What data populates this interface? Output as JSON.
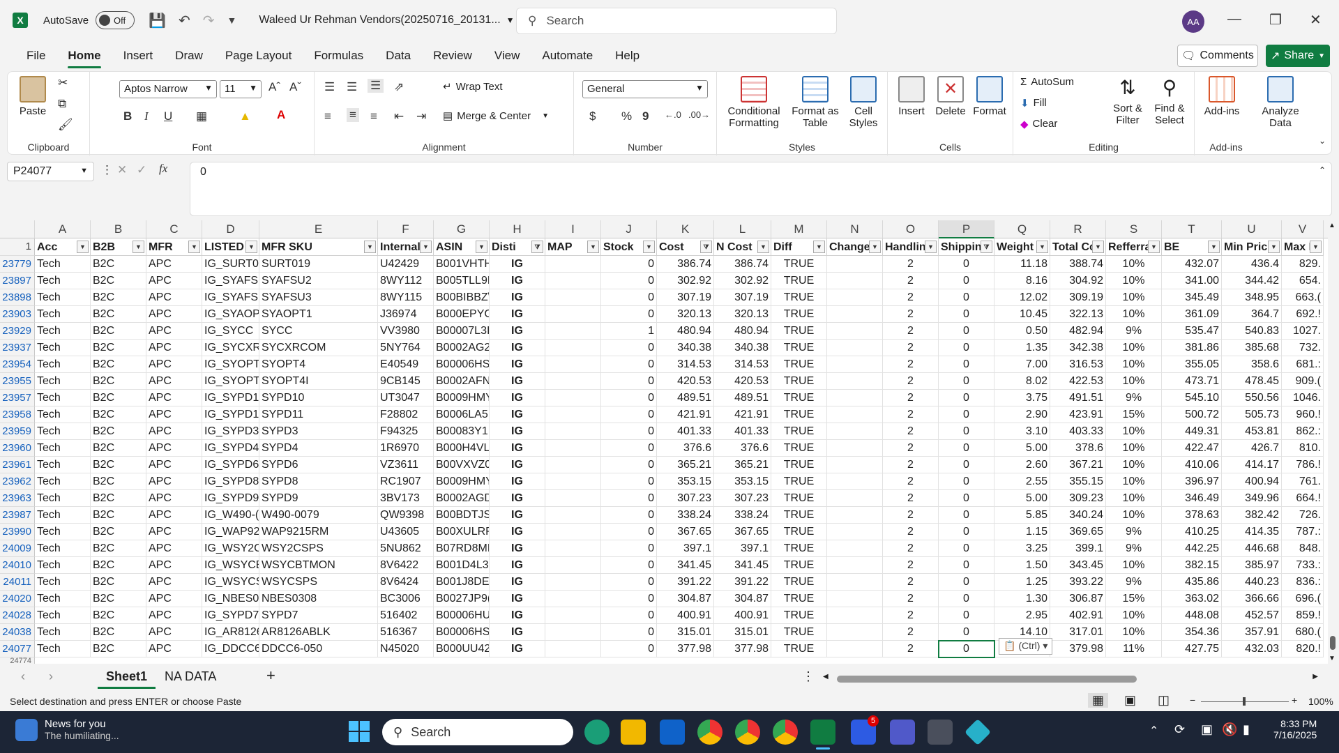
{
  "titlebar": {
    "autosave_label": "AutoSave",
    "autosave_state": "Off",
    "document_title": "Waleed Ur Rehman Vendors(20250716_20131...",
    "search_placeholder": "Search",
    "avatar_initials": "AA"
  },
  "menu": {
    "tabs": [
      "File",
      "Home",
      "Insert",
      "Draw",
      "Page Layout",
      "Formulas",
      "Data",
      "Review",
      "View",
      "Automate",
      "Help"
    ],
    "active": "Home",
    "comments_label": "Comments",
    "share_label": "Share"
  },
  "ribbon": {
    "clipboard": {
      "label": "Clipboard",
      "paste": "Paste"
    },
    "font": {
      "label": "Font",
      "name": "Aptos Narrow",
      "size": "11",
      "bold": "B",
      "italic": "I",
      "underline": "U"
    },
    "alignment": {
      "label": "Alignment",
      "wrap_text": "Wrap Text",
      "merge_center": "Merge & Center"
    },
    "number": {
      "label": "Number",
      "format": "General",
      "currency": "$",
      "percent": "%",
      "comma": "9"
    },
    "styles": {
      "label": "Styles",
      "conditional": [
        "Conditional",
        "Formatting"
      ],
      "format_table": [
        "Format as",
        "Table"
      ],
      "cell_styles": [
        "Cell",
        "Styles"
      ]
    },
    "cells": {
      "label": "Cells",
      "insert": "Insert",
      "delete": "Delete",
      "format": "Format"
    },
    "editing": {
      "label": "Editing",
      "autosum": "AutoSum",
      "fill": "Fill",
      "clear": "Clear",
      "sort_filter": [
        "Sort &",
        "Filter"
      ],
      "find_select": [
        "Find &",
        "Select"
      ]
    },
    "addins": {
      "label": "Add-ins",
      "addins": "Add-ins",
      "analyze": [
        "Analyze",
        "Data"
      ]
    }
  },
  "formula_bar": {
    "name_box": "P24077",
    "formula": "0"
  },
  "grid": {
    "columns": [
      "A",
      "B",
      "C",
      "D",
      "E",
      "F",
      "G",
      "H",
      "I",
      "J",
      "K",
      "L",
      "M",
      "N",
      "O",
      "P",
      "Q",
      "R",
      "S",
      "T",
      "U",
      "V"
    ],
    "selected_column": "P",
    "header_row_number": "1",
    "headers": [
      "Acc",
      "B2B",
      "MFR",
      "LISTED",
      "MFR SKU",
      "Internal",
      "ASIN",
      "Disti",
      "MAP",
      "Stock",
      "Cost",
      "N Cost",
      "Diff",
      "Change",
      "Handlin",
      "Shippin",
      "Weight",
      "Total Co",
      "Refferra",
      "BE",
      "Min Pric",
      "Max Pr"
    ],
    "filtered_columns": [
      "H",
      "K",
      "P"
    ],
    "rows": [
      [
        "23779",
        "Tech",
        "B2C",
        "APC",
        "IG_SURT01",
        "SURT019",
        "U42429",
        "B001VHTH",
        "IG",
        "",
        "0",
        "386.74",
        "386.74",
        "TRUE",
        "",
        "2",
        "0",
        "11.18",
        "388.74",
        "10%",
        "432.07",
        "436.4",
        "829."
      ],
      [
        "23897",
        "Tech",
        "B2C",
        "APC",
        "IG_SYAFSL",
        "SYAFSU2",
        "8WY112",
        "B005TLL9E",
        "IG",
        "",
        "0",
        "302.92",
        "302.92",
        "TRUE",
        "",
        "2",
        "0",
        "8.16",
        "304.92",
        "10%",
        "341.00",
        "344.42",
        "654."
      ],
      [
        "23898",
        "Tech",
        "B2C",
        "APC",
        "IG_SYAFSL",
        "SYAFSU3",
        "8WY115",
        "B00BIBBZ\\",
        "IG",
        "",
        "0",
        "307.19",
        "307.19",
        "TRUE",
        "",
        "2",
        "0",
        "12.02",
        "309.19",
        "10%",
        "345.49",
        "348.95",
        "663.("
      ],
      [
        "23903",
        "Tech",
        "B2C",
        "APC",
        "IG_SYAOP",
        "SYAOPT1",
        "J36974",
        "B000EPYG",
        "IG",
        "",
        "0",
        "320.13",
        "320.13",
        "TRUE",
        "",
        "2",
        "0",
        "10.45",
        "322.13",
        "10%",
        "361.09",
        "364.7",
        "692.!"
      ],
      [
        "23929",
        "Tech",
        "B2C",
        "APC",
        "IG_SYCC",
        "SYCC",
        "VV3980",
        "B00007L3I",
        "IG",
        "",
        "1",
        "480.94",
        "480.94",
        "TRUE",
        "",
        "2",
        "0",
        "0.50",
        "482.94",
        "9%",
        "535.47",
        "540.83",
        "1027."
      ],
      [
        "23937",
        "Tech",
        "B2C",
        "APC",
        "IG_SYCXR(",
        "SYCXRCOM",
        "5NY764",
        "B0002AG2",
        "IG",
        "",
        "0",
        "340.38",
        "340.38",
        "TRUE",
        "",
        "2",
        "0",
        "1.35",
        "342.38",
        "10%",
        "381.86",
        "385.68",
        "732."
      ],
      [
        "23954",
        "Tech",
        "B2C",
        "APC",
        "IG_SYOPT4",
        "SYOPT4",
        "E40549",
        "B00006HS",
        "IG",
        "",
        "0",
        "314.53",
        "314.53",
        "TRUE",
        "",
        "2",
        "0",
        "7.00",
        "316.53",
        "10%",
        "355.05",
        "358.6",
        "681.:"
      ],
      [
        "23955",
        "Tech",
        "B2C",
        "APC",
        "IG_SYOPT4",
        "SYOPT4I",
        "9CB145",
        "B0002AFN",
        "IG",
        "",
        "0",
        "420.53",
        "420.53",
        "TRUE",
        "",
        "2",
        "0",
        "8.02",
        "422.53",
        "10%",
        "473.71",
        "478.45",
        "909.("
      ],
      [
        "23957",
        "Tech",
        "B2C",
        "APC",
        "IG_SYPD1(",
        "SYPD10",
        "UT3047",
        "B0009HMY",
        "IG",
        "",
        "0",
        "489.51",
        "489.51",
        "TRUE",
        "",
        "2",
        "0",
        "3.75",
        "491.51",
        "9%",
        "545.10",
        "550.56",
        "1046."
      ],
      [
        "23958",
        "Tech",
        "B2C",
        "APC",
        "IG_SYPD11",
        "SYPD11",
        "F28802",
        "B0006LA5I",
        "IG",
        "",
        "0",
        "421.91",
        "421.91",
        "TRUE",
        "",
        "2",
        "0",
        "2.90",
        "423.91",
        "15%",
        "500.72",
        "505.73",
        "960.!"
      ],
      [
        "23959",
        "Tech",
        "B2C",
        "APC",
        "IG_SYPD3",
        "SYPD3",
        "F94325",
        "B00083Y1I",
        "IG",
        "",
        "0",
        "401.33",
        "401.33",
        "TRUE",
        "",
        "2",
        "0",
        "3.10",
        "403.33",
        "10%",
        "449.31",
        "453.81",
        "862.:"
      ],
      [
        "23960",
        "Tech",
        "B2C",
        "APC",
        "IG_SYPD4",
        "SYPD4",
        "1R6970",
        "B000H4VL",
        "IG",
        "",
        "0",
        "376.6",
        "376.6",
        "TRUE",
        "",
        "2",
        "0",
        "5.00",
        "378.6",
        "10%",
        "422.47",
        "426.7",
        "810."
      ],
      [
        "23961",
        "Tech",
        "B2C",
        "APC",
        "IG_SYPD6",
        "SYPD6",
        "VZ3611",
        "B00VXVZ0I",
        "IG",
        "",
        "0",
        "365.21",
        "365.21",
        "TRUE",
        "",
        "2",
        "0",
        "2.60",
        "367.21",
        "10%",
        "410.06",
        "414.17",
        "786.!"
      ],
      [
        "23962",
        "Tech",
        "B2C",
        "APC",
        "IG_SYPD8",
        "SYPD8",
        "RC1907",
        "B0009HMY",
        "IG",
        "",
        "0",
        "353.15",
        "353.15",
        "TRUE",
        "",
        "2",
        "0",
        "2.55",
        "355.15",
        "10%",
        "396.97",
        "400.94",
        "761."
      ],
      [
        "23963",
        "Tech",
        "B2C",
        "APC",
        "IG_SYPD9",
        "SYPD9",
        "3BV173",
        "B0002AGD",
        "IG",
        "",
        "0",
        "307.23",
        "307.23",
        "TRUE",
        "",
        "2",
        "0",
        "5.00",
        "309.23",
        "10%",
        "346.49",
        "349.96",
        "664.!"
      ],
      [
        "23987",
        "Tech",
        "B2C",
        "APC",
        "IG_W490-(",
        "W490-0079",
        "QW9398",
        "B00BDTJS:",
        "IG",
        "",
        "0",
        "338.24",
        "338.24",
        "TRUE",
        "",
        "2",
        "0",
        "5.85",
        "340.24",
        "10%",
        "378.63",
        "382.42",
        "726."
      ],
      [
        "23990",
        "Tech",
        "B2C",
        "APC",
        "IG_WAP92",
        "WAP9215RM",
        "U43605",
        "B00XULRP",
        "IG",
        "",
        "0",
        "367.65",
        "367.65",
        "TRUE",
        "",
        "2",
        "0",
        "1.15",
        "369.65",
        "9%",
        "410.25",
        "414.35",
        "787.:"
      ],
      [
        "24009",
        "Tech",
        "B2C",
        "APC",
        "IG_WSY2C",
        "WSY2CSPS",
        "5NU862",
        "B07RD8MI",
        "IG",
        "",
        "0",
        "397.1",
        "397.1",
        "TRUE",
        "",
        "2",
        "0",
        "3.25",
        "399.1",
        "9%",
        "442.25",
        "446.68",
        "848."
      ],
      [
        "24010",
        "Tech",
        "B2C",
        "APC",
        "IG_WSYCB",
        "WSYCBTMON",
        "8V6422",
        "B001D4L3:",
        "IG",
        "",
        "0",
        "341.45",
        "341.45",
        "TRUE",
        "",
        "2",
        "0",
        "1.50",
        "343.45",
        "10%",
        "382.15",
        "385.97",
        "733.:"
      ],
      [
        "24011",
        "Tech",
        "B2C",
        "APC",
        "IG_WSYCS",
        "WSYCSPS",
        "8V6424",
        "B001J8DE:",
        "IG",
        "",
        "0",
        "391.22",
        "391.22",
        "TRUE",
        "",
        "2",
        "0",
        "1.25",
        "393.22",
        "9%",
        "435.86",
        "440.23",
        "836.:"
      ],
      [
        "24020",
        "Tech",
        "B2C",
        "APC",
        "IG_NBES0:",
        "NBES0308",
        "BC3006",
        "B0027JP9(",
        "IG",
        "",
        "0",
        "304.87",
        "304.87",
        "TRUE",
        "",
        "2",
        "0",
        "1.30",
        "306.87",
        "15%",
        "363.02",
        "366.66",
        "696.("
      ],
      [
        "24028",
        "Tech",
        "B2C",
        "APC",
        "IG_SYPD7",
        "SYPD7",
        "516402",
        "B00006HU",
        "IG",
        "",
        "0",
        "400.91",
        "400.91",
        "TRUE",
        "",
        "2",
        "0",
        "2.95",
        "402.91",
        "10%",
        "448.08",
        "452.57",
        "859.!"
      ],
      [
        "24038",
        "Tech",
        "B2C",
        "APC",
        "IG_AR8126",
        "AR8126ABLK",
        "516367",
        "B00006HS",
        "IG",
        "",
        "0",
        "315.01",
        "315.01",
        "TRUE",
        "",
        "2",
        "0",
        "14.10",
        "317.01",
        "10%",
        "354.36",
        "357.91",
        "680.("
      ],
      [
        "24077",
        "Tech",
        "B2C",
        "APC",
        "IG_DDCC6",
        "DDCC6-050",
        "N45020",
        "B000UU42",
        "IG",
        "",
        "0",
        "377.98",
        "377.98",
        "TRUE",
        "",
        "2",
        "0",
        "",
        "379.98",
        "11%",
        "427.75",
        "432.03",
        "820.!"
      ]
    ],
    "partial_next_row": "24774",
    "paste_tag": "(Ctrl)"
  },
  "sheets": {
    "tabs": [
      "Sheet1",
      "NA DATA"
    ],
    "active": "Sheet1",
    "add": "+"
  },
  "status": {
    "message": "Select destination and press ENTER or choose Paste",
    "zoom": "100%"
  },
  "taskbar": {
    "news_title": "News for you",
    "news_sub": "The humiliating...",
    "search": "Search",
    "time": "8:33 PM",
    "date": "7/16/2025",
    "badge_count": "5"
  }
}
